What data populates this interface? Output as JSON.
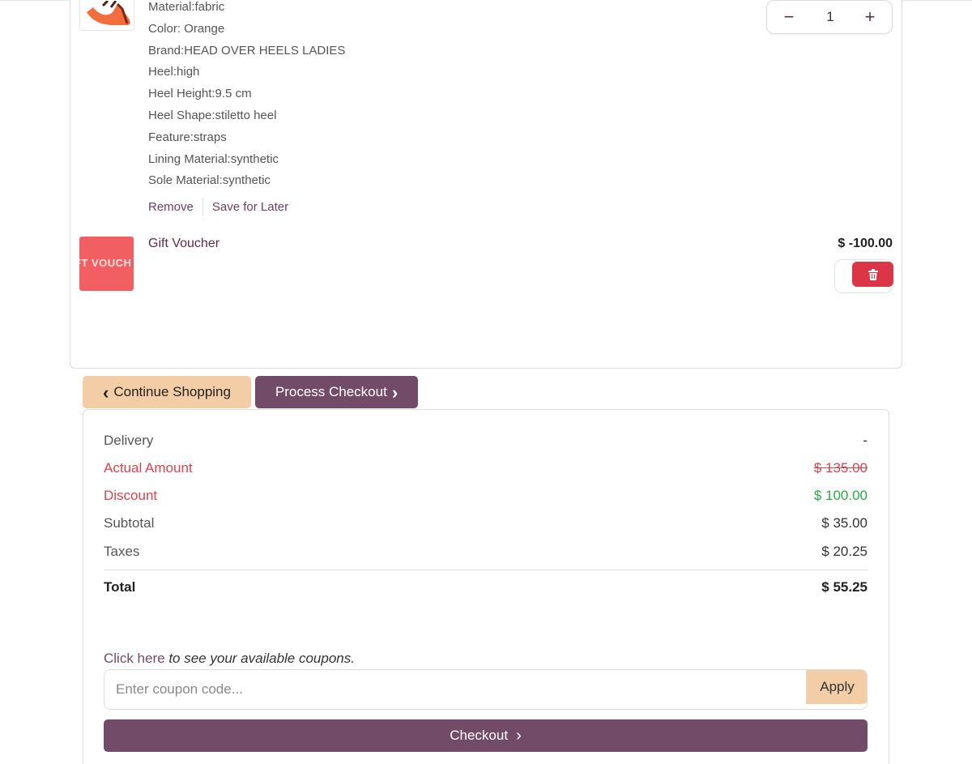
{
  "product": {
    "image_icon": "orange-heels-shoe-icon",
    "attributes": [
      "Material:fabric",
      "Color: Orange",
      "Brand:HEAD OVER HEELS LADIES",
      "Heel:high",
      "Heel Height:9.5 cm",
      "Heel Shape:stiletto heel",
      "Feature:straps",
      "Lining Material:synthetic",
      "Sole Material:synthetic"
    ],
    "quantity": "1",
    "minus_icon": "−",
    "plus_icon": "+",
    "remove_label": "Remove",
    "save_for_later_label": "Save for Later"
  },
  "voucher": {
    "image_text": "FT VOUCH",
    "name": "Gift Voucher",
    "price": "$ -100.00",
    "delete_icon": "trash-icon"
  },
  "actions": {
    "continue_label": "Continue Shopping",
    "process_label": "Process Checkout",
    "continue_icon": "‹",
    "process_icon": "›"
  },
  "summary": {
    "delivery_label": "Delivery",
    "delivery_value": "-",
    "actual_label": "Actual Amount",
    "actual_value": "$ 135.00",
    "discount_label": "Discount",
    "discount_value": "$ 100.00",
    "subtotal_label": "Subtotal",
    "subtotal_value": "$ 35.00",
    "taxes_label": "Taxes",
    "taxes_value": "$ 20.25",
    "total_label": "Total",
    "total_value": "$ 55.25"
  },
  "coupon": {
    "click_label": "Click here",
    "hint_text": "to see your available coupons.",
    "placeholder": "Enter coupon code...",
    "apply_label": "Apply"
  },
  "checkout": {
    "label": "Checkout",
    "icon": "›"
  },
  "colors": {
    "brand": "#714b67",
    "accent": "#f3cda6",
    "danger": "#dc3545",
    "success": "#28a745"
  }
}
